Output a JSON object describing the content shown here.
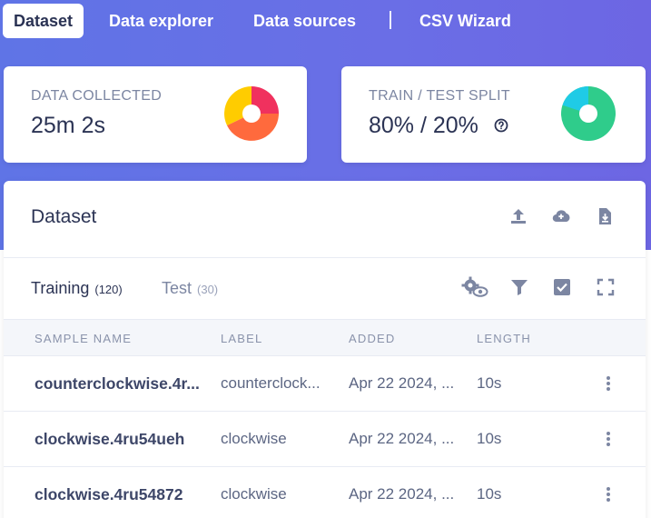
{
  "nav": {
    "tabs": [
      {
        "label": "Dataset",
        "active": true
      },
      {
        "label": "Data explorer",
        "active": false
      },
      {
        "label": "Data sources",
        "active": false
      },
      {
        "label": "CSV Wizard",
        "active": false
      }
    ]
  },
  "stats": {
    "data_collected": {
      "label": "DATA COLLECTED",
      "value": "25m 2s",
      "chart_icon": "pie-chart-icon",
      "colors": [
        "#f0315e",
        "#ff6a3d",
        "#ffcc00"
      ]
    },
    "train_test_split": {
      "label": "TRAIN / TEST SPLIT",
      "value": "80% / 20%",
      "help_icon": "question-circle-icon",
      "chart_icon": "pie-chart-icon",
      "colors": [
        "#2fcc8b",
        "#1fcbe6"
      ]
    }
  },
  "panel": {
    "title": "Dataset",
    "actions": [
      "upload-icon",
      "cloud-upload-icon",
      "download-file-icon"
    ],
    "tabs": [
      {
        "name": "Training",
        "count": "(120)",
        "active": true
      },
      {
        "name": "Test",
        "count": "(30)",
        "active": false
      }
    ],
    "tools": [
      "settings-eye-icon",
      "filter-icon",
      "checkbox-icon",
      "fullscreen-icon"
    ],
    "columns": [
      "SAMPLE NAME",
      "LABEL",
      "ADDED",
      "LENGTH"
    ],
    "rows": [
      {
        "name": "counterclockwise.4r...",
        "label": "counterclock...",
        "added": "Apr 22 2024, ...",
        "length": "10s"
      },
      {
        "name": "clockwise.4ru54ueh",
        "label": "clockwise",
        "added": "Apr 22 2024, ...",
        "length": "10s"
      },
      {
        "name": "clockwise.4ru54872",
        "label": "clockwise",
        "added": "Apr 22 2024, ...",
        "length": "10s"
      }
    ]
  }
}
